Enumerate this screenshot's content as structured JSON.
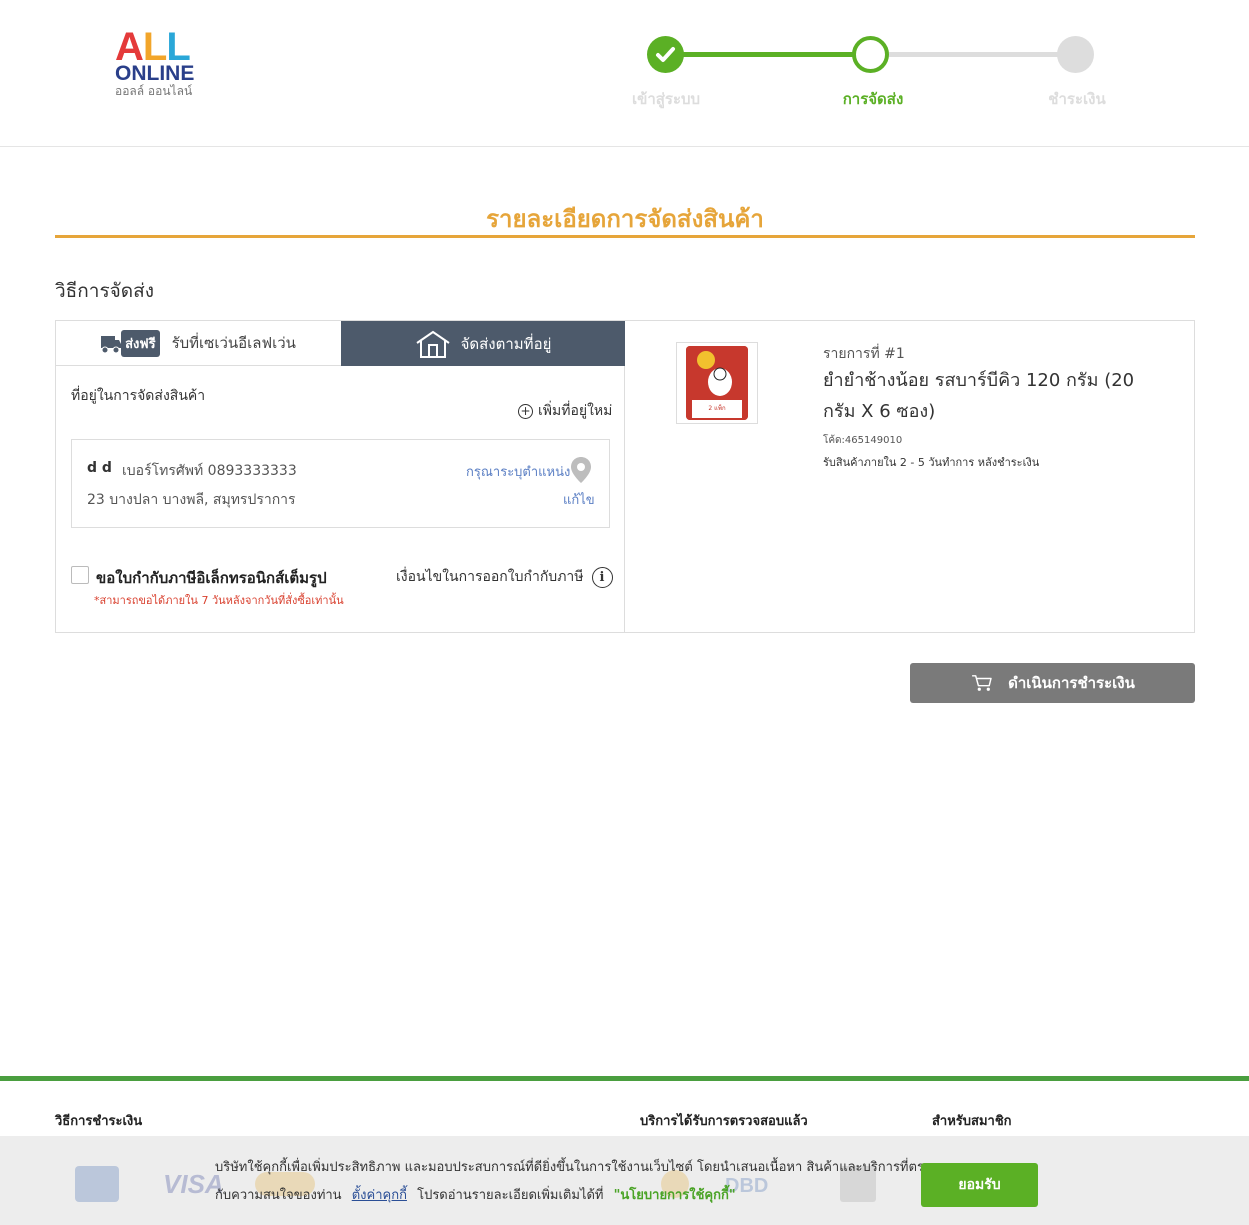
{
  "header": {
    "logo_all": [
      "A",
      "L",
      "L"
    ],
    "logo_online": "ONLINE",
    "logo_thai": "ออลล์ ออนไลน์",
    "steps": [
      {
        "label": "เข้าสู่ระบบ",
        "state": "done"
      },
      {
        "label": "การจัดส่ง",
        "state": "current"
      },
      {
        "label": "ชำระเงิน",
        "state": "pending"
      }
    ],
    "colors": {
      "done": "#5bb025",
      "pending": "#dddddd",
      "accent": "#e6a53a"
    }
  },
  "page_title": "รายละเอียดการจัดส่งสินค้า",
  "section_title": "วิธีการจัดส่ง",
  "tabs": {
    "pickup_badge": "ส่งฟรี",
    "pickup_label": "รับที่เซเว่นอีเลฟเว่น",
    "home_label": "จัดส่งตามที่อยู่"
  },
  "address": {
    "heading": "ที่อยู่ในการจัดส่งสินค้า",
    "add_new": "เพิ่มที่อยู่ใหม่",
    "name": "d d",
    "phone": "เบอร์โทรศัพท์ 0893333333",
    "line": "23 บางปลา บางพลี, สมุทรปราการ",
    "locate": "กรุณาระบุตำแหน่ง",
    "edit": "แก้ไข"
  },
  "tax": {
    "label": "ขอใบกำกับภาษีอิเล็กทรอนิกส์เต็มรูป",
    "note": "*สามารถขอได้ภายใน 7 วันหลังจากวันที่สั่งซื้อเท่านั้น",
    "conditions": "เงื่อนไขในการออกใบกำกับภาษี"
  },
  "product": {
    "item_no": "รายการที่ #1",
    "name": "ยำยำช้างน้อย รสบาร์บีคิว 120 กรัม (20 กรัม X 6 ซอง)",
    "code": "โค้ด:465149010",
    "shipping": "รับสินค้าภายใน 2 - 5 วันทำการ หลังชำระเงิน",
    "pack_label": "2 แพ็ก"
  },
  "pay_button": "ดำเนินการชำระเงิน",
  "footer": {
    "payment_heading": "วิธีการชำระเงิน",
    "verified_heading": "บริการได้รับการตรวจสอบแล้ว",
    "member_heading": "สำหรับสมาชิก"
  },
  "cookie": {
    "text1": "บริษัทใช้คุกกี้เพื่อเพิ่มประสิทธิภาพ และมอบประสบการณ์ที่ดียิ่งขึ้นในการใช้งานเว็บไซต์ โดยนำเสนอเนื้อหา สินค้าและบริการที่ตรง",
    "text2_a": "กับความสนใจของท่าน",
    "settings_link": "ตั้งค่าคุกกี้",
    "text2_b": "โปรดอ่านรายละเอียดเพิ่มเติมได้ที่",
    "policy": "\"นโยบายการใช้คุกกี้\"",
    "accept": "ยอมรับ"
  }
}
